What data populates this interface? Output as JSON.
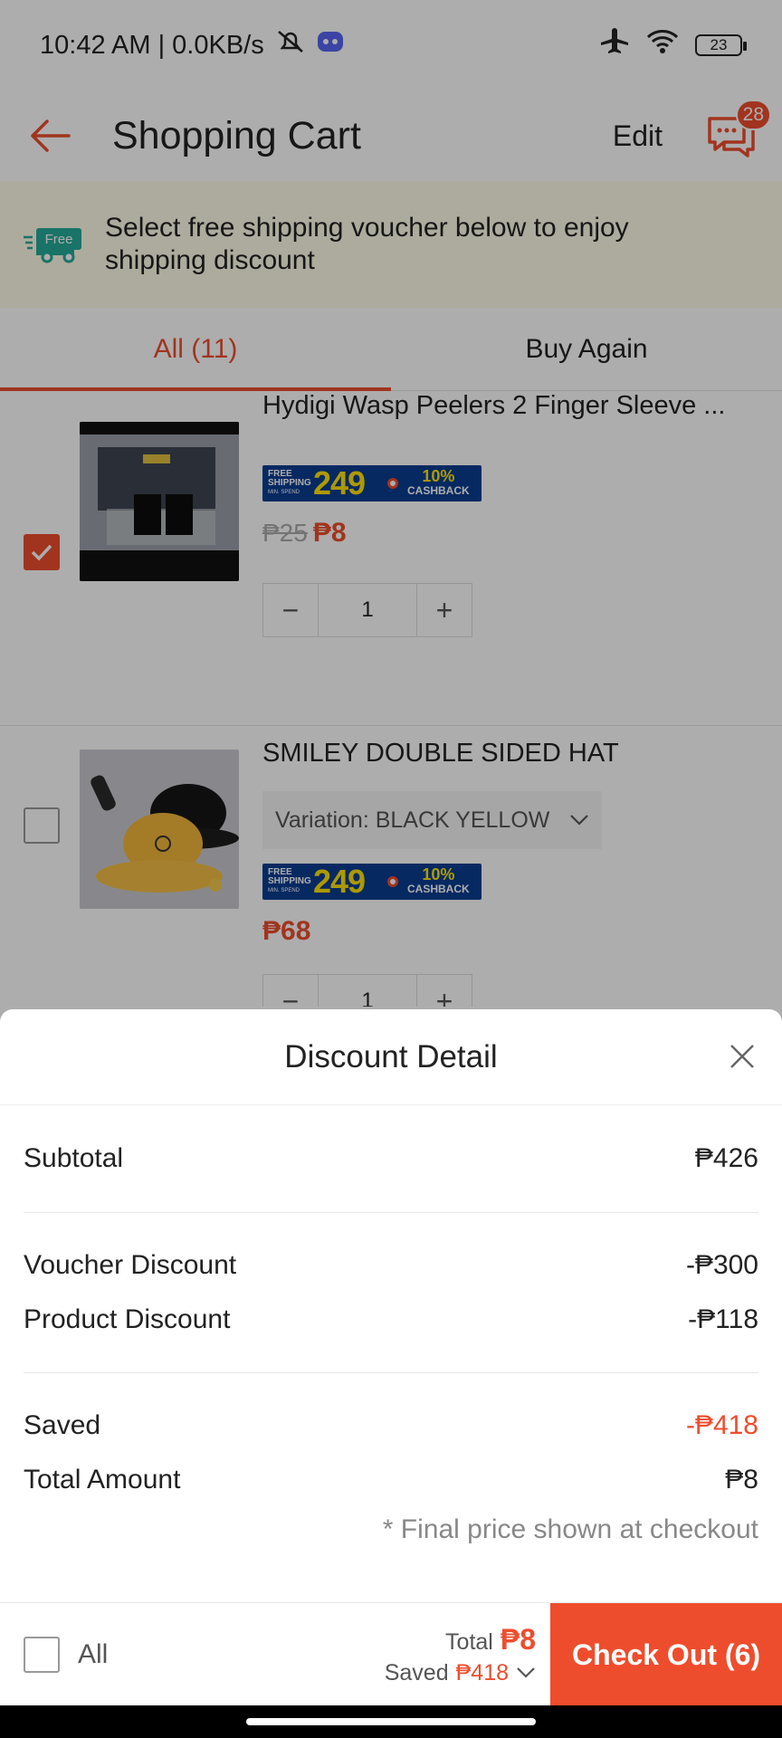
{
  "status_bar": {
    "time": "10:42 AM | 0.0KB/s",
    "battery": "23"
  },
  "header": {
    "title": "Shopping Cart",
    "edit_label": "Edit",
    "chat_badge": "28"
  },
  "shipping_banner": {
    "icon_label": "Free",
    "text": "Select free shipping voucher below to enjoy shipping discount"
  },
  "tabs": [
    {
      "label": "All (11)",
      "active": true
    },
    {
      "label": "Buy Again",
      "active": false
    }
  ],
  "promo_badge": {
    "shipping_line1": "FREE",
    "shipping_line2": "SHIPPING",
    "min_spend": "MIN. SPEND",
    "amount": "249",
    "cashback_pct": "10%",
    "cashback_label": "CASHBACK"
  },
  "cart_items": [
    {
      "title": "Hydigi Wasp Peelers 2 Finger Sleeve ...",
      "checked": true,
      "price_original": "₱25",
      "price": "₱8",
      "quantity": "1",
      "variation": ""
    },
    {
      "title": "SMILEY DOUBLE SIDED HAT",
      "checked": false,
      "price_original": "",
      "price": "₱68",
      "quantity": "1",
      "variation": "Variation: BLACK YELLOW"
    }
  ],
  "discount_sheet": {
    "title": "Discount Detail",
    "subtotal_label": "Subtotal",
    "subtotal": "₱426",
    "voucher_label": "Voucher Discount",
    "voucher": "-₱300",
    "product_label": "Product Discount",
    "product": "-₱118",
    "saved_label": "Saved",
    "saved": "-₱418",
    "total_label": "Total Amount",
    "total": "₱8",
    "note": "* Final price shown at checkout"
  },
  "bottom_bar": {
    "all_label": "All",
    "total_label": "Total",
    "total": "₱8",
    "saved_label": "Saved",
    "saved": "₱418",
    "checkout_label": "Check Out (6)"
  },
  "colors": {
    "accent": "#ee4d2d",
    "promo_blue": "#0a3d91",
    "promo_yellow": "#ffe200",
    "banner_bg": "#fffde8"
  }
}
